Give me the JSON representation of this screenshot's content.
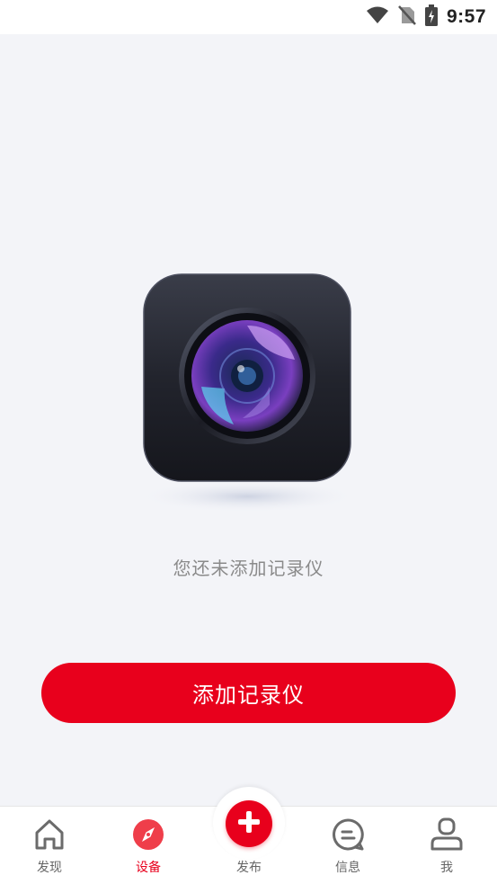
{
  "status_bar": {
    "time": "9:57",
    "icons": [
      "wifi-icon",
      "no-sim-icon",
      "battery-charging-icon"
    ]
  },
  "empty_state": {
    "illustration": "dashcam-lens-icon",
    "message": "您还未添加记录仪"
  },
  "primary_action": {
    "label": "添加记录仪"
  },
  "tab_bar": {
    "tabs": [
      {
        "id": "discover",
        "label": "发现",
        "icon": "home-icon",
        "active": false
      },
      {
        "id": "device",
        "label": "设备",
        "icon": "compass-icon",
        "active": true
      },
      {
        "id": "publish",
        "label": "发布",
        "icon": "plus-icon",
        "active": false
      },
      {
        "id": "messages",
        "label": "信息",
        "icon": "chat-bubble-icon",
        "active": false
      },
      {
        "id": "me",
        "label": "我",
        "icon": "user-icon",
        "active": false
      }
    ]
  },
  "colors": {
    "accent": "#e8001c",
    "background": "#f3f4f8",
    "tab_inactive": "#666666",
    "message_text": "#8a8a8a"
  }
}
